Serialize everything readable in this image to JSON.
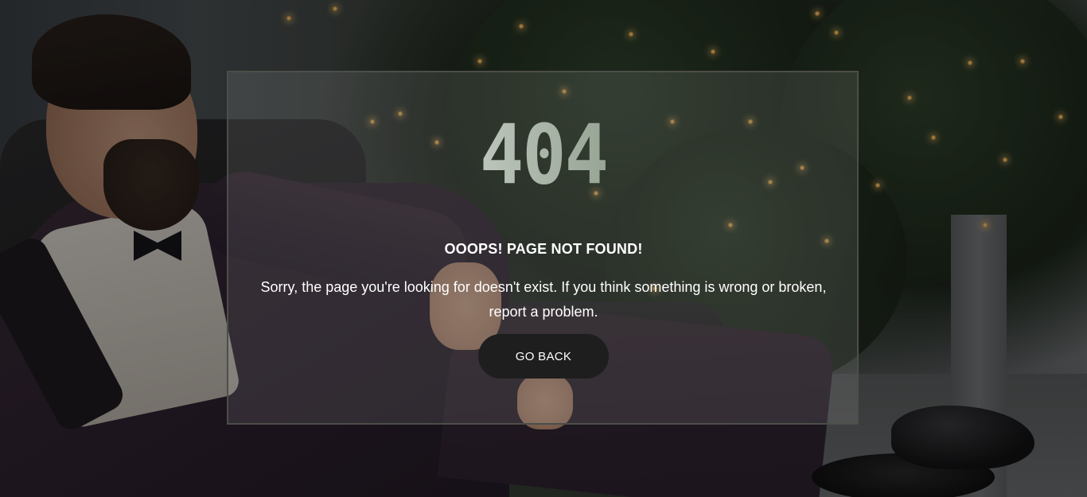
{
  "error": {
    "code": "404",
    "heading": "OOOPS! PAGE NOT FOUND!",
    "message": "Sorry, the page you're looking for doesn't exist. If you think something is wrong or broken, report a problem.",
    "back_button_label": "GO BACK"
  },
  "colors": {
    "card_border": "#4c4e49",
    "button_bg": "#1e1e1e",
    "text": "#ffffff"
  }
}
